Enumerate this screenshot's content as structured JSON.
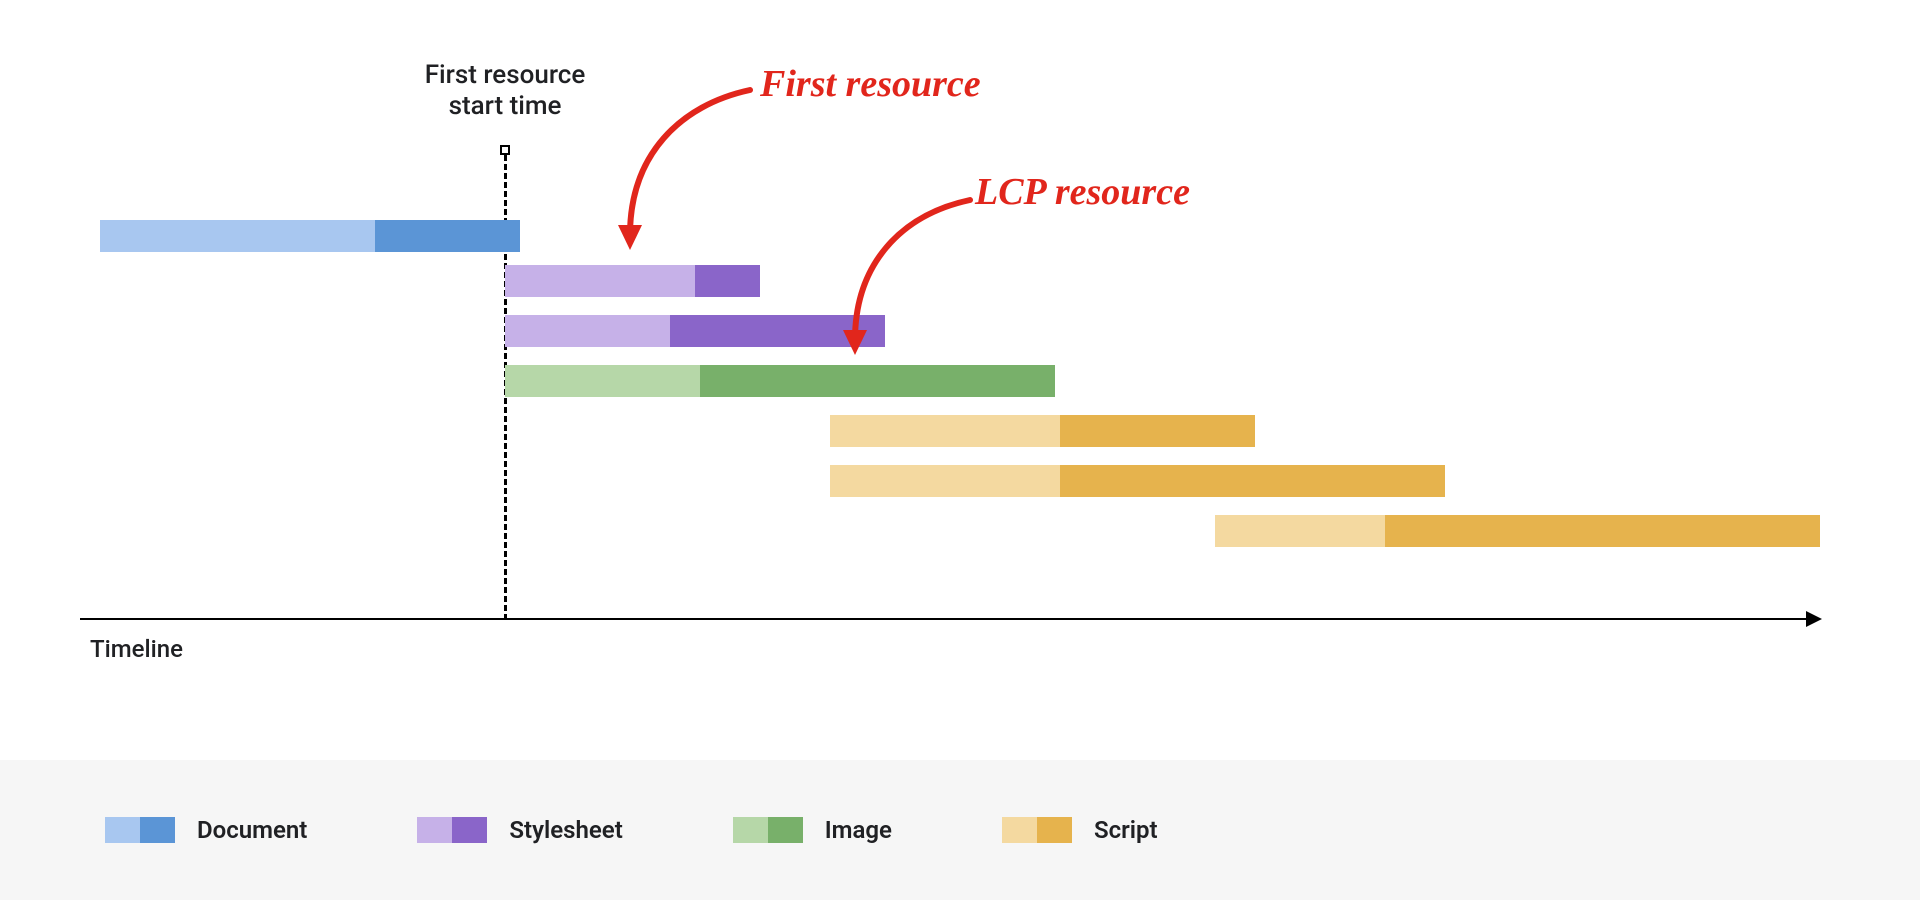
{
  "chart_data": {
    "type": "bar",
    "title": "",
    "xlabel": "Timeline",
    "ylabel": "",
    "marker_label": "First resource\nstart time",
    "annotations": {
      "first_resource": "First resource",
      "lcp_resource": "LCP resource"
    },
    "legend": [
      {
        "name": "Document",
        "light": "#a8c7f0",
        "dark": "#5b95d6"
      },
      {
        "name": "Stylesheet",
        "light": "#c6b1e8",
        "dark": "#8a65c9"
      },
      {
        "name": "Image",
        "light": "#b6d7a8",
        "dark": "#78b06a"
      },
      {
        "name": "Script",
        "light": "#f4d9a0",
        "dark": "#e6b34d"
      }
    ],
    "series": [
      {
        "name": "Document",
        "start": 0,
        "split": 275,
        "end": 420
      },
      {
        "name": "Stylesheet",
        "start": 405,
        "split": 595,
        "end": 660
      },
      {
        "name": "Stylesheet",
        "start": 405,
        "split": 570,
        "end": 785
      },
      {
        "name": "Image",
        "start": 405,
        "split": 600,
        "end": 955
      },
      {
        "name": "Script",
        "start": 730,
        "split": 960,
        "end": 1155
      },
      {
        "name": "Script",
        "start": 730,
        "split": 960,
        "end": 1345
      },
      {
        "name": "Script",
        "start": 1115,
        "split": 1285,
        "end": 1720
      }
    ],
    "first_resource_start_x": 405,
    "xlim": [
      0,
      1720
    ]
  }
}
